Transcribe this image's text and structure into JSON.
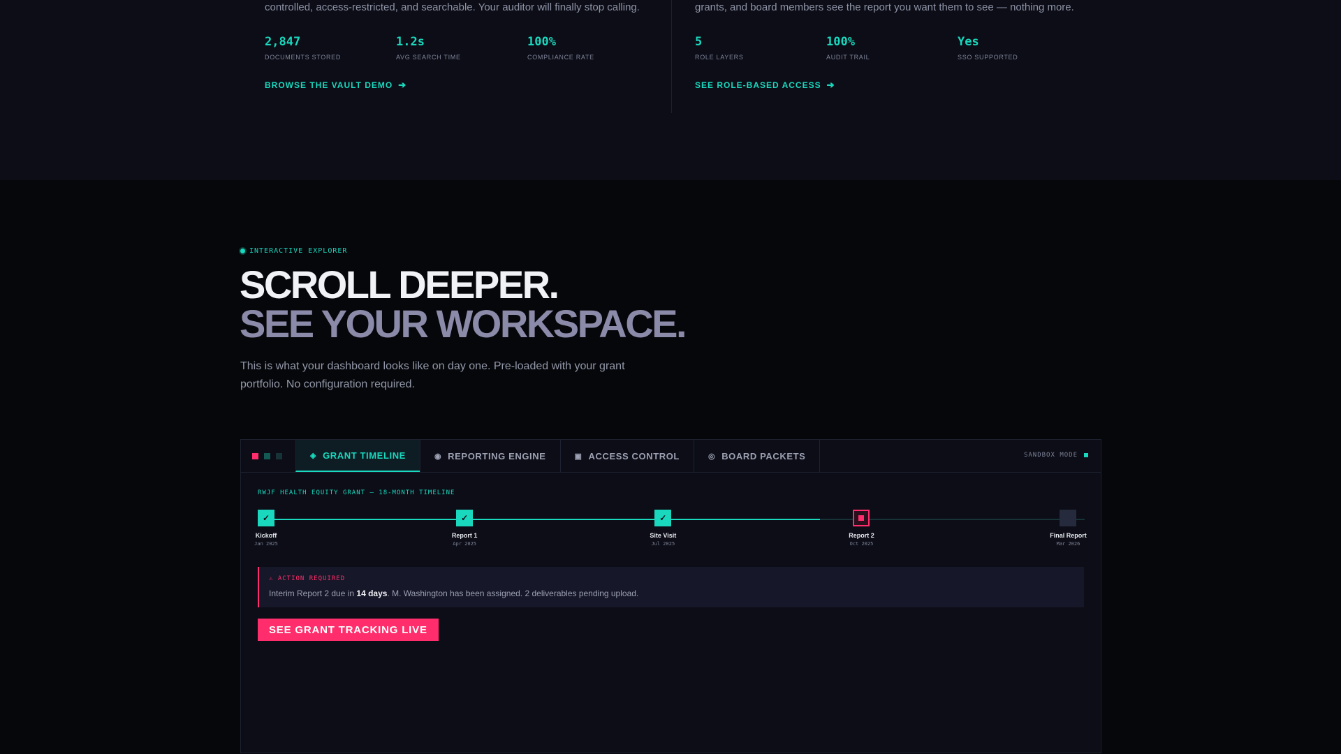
{
  "vault": {
    "description": "controlled, access-restricted, and searchable. Your auditor will finally stop calling.",
    "stats": [
      {
        "value": "2,847",
        "label": "DOCUMENTS STORED"
      },
      {
        "value": "1.2s",
        "label": "AVG SEARCH TIME"
      },
      {
        "value": "100%",
        "label": "COMPLIANCE RATE"
      }
    ],
    "link": "BROWSE THE VAULT DEMO"
  },
  "access": {
    "description": "grants, and board members see the report you want them to see — nothing more.",
    "stats": [
      {
        "value": "5",
        "label": "ROLE LAYERS"
      },
      {
        "value": "100%",
        "label": "AUDIT TRAIL"
      },
      {
        "value": "Yes",
        "label": "SSO SUPPORTED"
      }
    ],
    "link": "SEE ROLE-BASED ACCESS"
  },
  "explorer": {
    "eyebrow": "INTERACTIVE EXPLORER",
    "headline_1": "SCROLL DEEPER.",
    "headline_2": "SEE YOUR WORKSPACE.",
    "lead": "This is what your dashboard looks like on day one. Pre-loaded with your grant portfolio. No configuration required."
  },
  "panel": {
    "tabs": [
      {
        "label": "GRANT TIMELINE",
        "icon": "◈",
        "icon_name": "diamond-icon",
        "active": true
      },
      {
        "label": "REPORTING ENGINE",
        "icon": "◉",
        "icon_name": "radio-circle-icon",
        "active": false
      },
      {
        "label": "ACCESS CONTROL",
        "icon": "▣",
        "icon_name": "square-icon",
        "active": false
      },
      {
        "label": "BOARD PACKETS",
        "icon": "◎",
        "icon_name": "target-icon",
        "active": false
      }
    ],
    "sandbox_label": "SANDBOX MODE",
    "timeline": {
      "title": "RWJF HEALTH EQUITY GRANT — 18-MONTH TIMELINE",
      "progress": 0.68,
      "milestones": [
        {
          "name": "Kickoff",
          "date": "Jan 2025",
          "status": "done",
          "position": 0.0
        },
        {
          "name": "Report 1",
          "date": "Apr 2025",
          "status": "done",
          "position": 0.24
        },
        {
          "name": "Site Visit",
          "date": "Jul 2025",
          "status": "done",
          "position": 0.48
        },
        {
          "name": "Report 2",
          "date": "Oct 2025",
          "status": "current",
          "position": 0.72
        },
        {
          "name": "Final Report",
          "date": "Mar 2026",
          "status": "future",
          "position": 0.97
        }
      ]
    },
    "alert": {
      "title": "⚠ ACTION REQUIRED",
      "body_pre": "Interim Report 2 due in ",
      "body_strong": "14 days",
      "body_post": ". M. Washington has been assigned. 2 deliverables pending upload."
    },
    "cta": "SEE GRANT TRACKING LIVE"
  },
  "colors": {
    "accent": "#19d8be",
    "alert": "#ff2d6b",
    "window_dots": [
      "#ff2d6b",
      "#135a55",
      "#173338"
    ]
  }
}
